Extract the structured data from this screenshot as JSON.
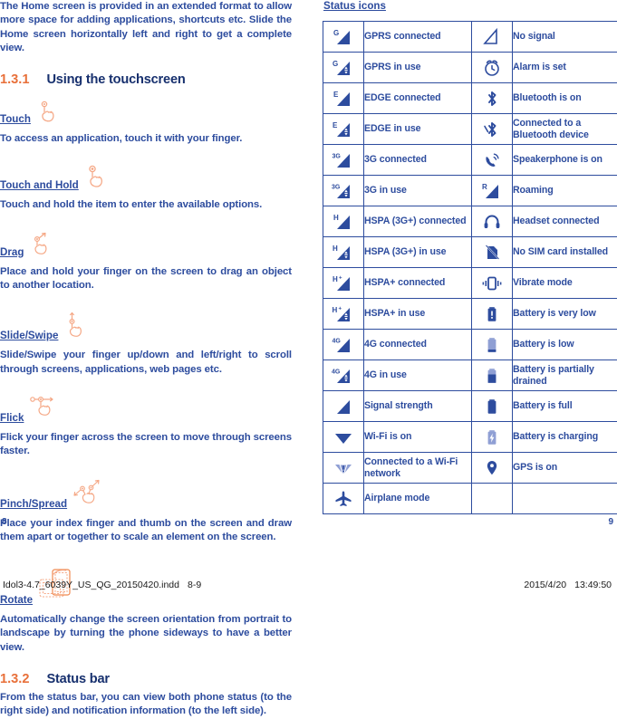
{
  "left_page": {
    "intro_paragraph": "The Home screen is provided in an extended format to allow more space for adding applications, shortcuts etc. Slide the Home screen horizontally left and right to get a complete view.",
    "section_1": {
      "number": "1.3.1",
      "title": "Using the touchscreen"
    },
    "gestures": [
      {
        "name": "Touch",
        "icon": "hand-touch-icon",
        "description": "To access an application, touch it with your finger."
      },
      {
        "name": "Touch and Hold",
        "icon": "hand-touch-hold-icon",
        "description": "Touch and hold the item to enter the available options."
      },
      {
        "name": "Drag",
        "icon": "hand-drag-icon",
        "description": "Place and hold your finger on the screen to drag an object to another location."
      },
      {
        "name": "Slide/Swipe",
        "icon": "hand-slide-swipe-icon",
        "description": "Slide/Swipe your finger up/down and left/right to scroll through screens, applications, web pages etc."
      },
      {
        "name": "Flick",
        "icon": "hand-flick-icon",
        "description": "Flick your finger across the screen to move through screens faster."
      },
      {
        "name": "Pinch/Spread",
        "icon": "hand-pinch-spread-icon",
        "description": "Place your index finger and thumb on the screen and draw them apart or together to scale an element on the screen."
      },
      {
        "name": "Rotate",
        "icon": "phone-rotate-icon",
        "description": "Automatically change the screen orientation from portrait to landscape by turning the phone sideways to have a better view."
      }
    ],
    "section_2": {
      "number": "1.3.2",
      "title": "Status bar",
      "description": "From the status bar, you can view both phone status (to the right side) and notification information (to the left side)."
    },
    "page_number": "8"
  },
  "right_page": {
    "table_title": "Status icons",
    "rows": [
      {
        "left": {
          "icon": "gprs-connected-icon",
          "label": "GPRS connected"
        },
        "right": {
          "icon": "no-signal-icon",
          "label": "No signal"
        }
      },
      {
        "left": {
          "icon": "gprs-in-use-icon",
          "label": "GPRS in use"
        },
        "right": {
          "icon": "alarm-icon",
          "label": "Alarm is set"
        }
      },
      {
        "left": {
          "icon": "edge-connected-icon",
          "label": "EDGE connected"
        },
        "right": {
          "icon": "bluetooth-icon",
          "label": "Bluetooth is on"
        }
      },
      {
        "left": {
          "icon": "edge-in-use-icon",
          "label": "EDGE in use"
        },
        "right": {
          "icon": "bluetooth-connected-icon",
          "label": "Connected to a Bluetooth device"
        }
      },
      {
        "left": {
          "icon": "3g-connected-icon",
          "label": "3G connected"
        },
        "right": {
          "icon": "speakerphone-icon",
          "label": "Speakerphone is on"
        }
      },
      {
        "left": {
          "icon": "3g-in-use-icon",
          "label": "3G in use"
        },
        "right": {
          "icon": "roaming-icon",
          "label": "Roaming"
        }
      },
      {
        "left": {
          "icon": "hspa-connected-icon",
          "label": "HSPA (3G+) connected"
        },
        "right": {
          "icon": "headset-icon",
          "label": "Headset connected"
        }
      },
      {
        "left": {
          "icon": "hspa-in-use-icon",
          "label": "HSPA (3G+) in use"
        },
        "right": {
          "icon": "no-sim-icon",
          "label": "No SIM card installed"
        }
      },
      {
        "left": {
          "icon": "hspa-plus-connected-icon",
          "label": "HSPA+ connected"
        },
        "right": {
          "icon": "vibrate-icon",
          "label": "Vibrate mode"
        }
      },
      {
        "left": {
          "icon": "hspa-plus-in-use-icon",
          "label": "HSPA+ in use"
        },
        "right": {
          "icon": "battery-very-low-icon",
          "label": "Battery is very low"
        }
      },
      {
        "left": {
          "icon": "4g-connected-icon",
          "label": "4G connected"
        },
        "right": {
          "icon": "battery-low-icon",
          "label": "Battery is low"
        }
      },
      {
        "left": {
          "icon": "4g-in-use-icon",
          "label": "4G in use"
        },
        "right": {
          "icon": "battery-partial-icon",
          "label": "Battery is partially drained"
        }
      },
      {
        "left": {
          "icon": "signal-strength-icon",
          "label": "Signal strength"
        },
        "right": {
          "icon": "battery-full-icon",
          "label": "Battery is full"
        }
      },
      {
        "left": {
          "icon": "wifi-on-icon",
          "label": "Wi-Fi is on"
        },
        "right": {
          "icon": "battery-charging-icon",
          "label": "Battery is charging"
        }
      },
      {
        "left": {
          "icon": "wifi-connected-icon",
          "label": "Connected to a Wi-Fi network"
        },
        "right": {
          "icon": "gps-icon",
          "label": "GPS is on"
        }
      },
      {
        "left": {
          "icon": "airplane-mode-icon",
          "label": "Airplane mode"
        },
        "right": {
          "icon": "",
          "label": ""
        }
      }
    ],
    "page_number": "9"
  },
  "print_footer": {
    "file_name": "Idol3-4.7_6039Y_US_QG_20150420.indd",
    "page_range": "8-9",
    "date": "2015/4/20",
    "time": "13:49:50"
  },
  "colors": {
    "text_blue": "#2d4c9e",
    "heading_dark_blue": "#17306e",
    "accent_orange": "#e8703a",
    "icon_light": "#8f9fd4"
  }
}
